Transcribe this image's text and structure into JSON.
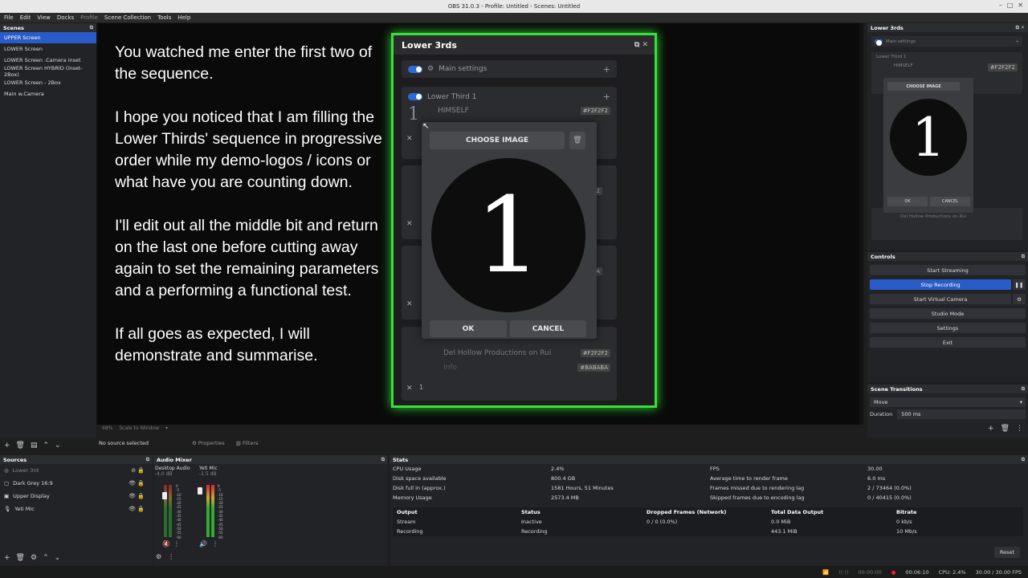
{
  "window": {
    "title": "OBS 31.0.3 - Profile: Untitled - Scenes: Untitled"
  },
  "menu": [
    "File",
    "Edit",
    "View",
    "Docks",
    "Profile",
    "Scene Collection",
    "Tools",
    "Help"
  ],
  "scenes": {
    "header": "Scenes",
    "items": [
      "UPPER Screen",
      "LOWER Screen",
      "LOWER Screen .Camera inset",
      "LOWER Screen  HYBRID (inset-2Box)",
      "LOWER Screen - 2Box",
      "Main  w.Camera"
    ]
  },
  "preview": {
    "overlay_paragraphs": [
      "You watched me enter the first two of the sequence.",
      "I hope you noticed that I am filling the Lower Thirds' sequence in progressive order while my demo-logos / icons or what have you are counting down.",
      "I'll edit out all the middle bit and return on the last one before cutting away again to set the remaining parameters and a performing a functional test.",
      "If all goes as expected, I will demonstrate and summarise."
    ],
    "zoom": "68%",
    "scale_mode": "Scale to Window"
  },
  "lower3rds": {
    "title": "Lower 3rds",
    "main_settings": "Main settings",
    "lt1_name": "Lower Third 1",
    "lt1_text": "HIMSELF",
    "lt1_color": "#F2F2F2",
    "card_colors": [
      "#F2F2F2",
      "#BABABA"
    ],
    "lt4_text": "Del Hollow Productions on Rui",
    "lt4_info": "Info",
    "lt4_color": "#F2F2F2",
    "lt4_color2": "#BABABA",
    "num_badge": "1"
  },
  "modal": {
    "choose_label": "CHOOSE IMAGE",
    "image_numeral": "1",
    "ok_label": "OK",
    "cancel_label": "CANCEL"
  },
  "lt_dock": {
    "header": "Lower 3rds",
    "main_settings": "Main settings",
    "lt1_name": "Lower Third 1",
    "lt1_text": "HIMSELF",
    "lt1_color": "#F2F2F2",
    "lt4_text": "Del Hollow Productions on Rui",
    "choose_label": "CHOOSE IMAGE",
    "numeral": "1",
    "ok_label": "OK",
    "cancel_label": "CANCEL"
  },
  "controls": {
    "header": "Controls",
    "buttons": [
      "Start Streaming",
      "Stop Recording",
      "Start Virtual Camera",
      "Studio Mode",
      "Settings",
      "Exit"
    ]
  },
  "transitions": {
    "header": "Scene Transitions",
    "type": "Move",
    "duration_label": "Duration",
    "duration_value": "500 ms"
  },
  "toolbar": {
    "no_source": "No source selected",
    "properties": "Properties",
    "filters": "Filters"
  },
  "sources": {
    "header": "Sources",
    "items": [
      "Lower 3rd",
      "Dark Grey 16:9",
      "Upper Display",
      "Yeti Mic"
    ]
  },
  "mixer": {
    "header": "Audio Mixer",
    "channels": [
      {
        "name": "Desktop Audio",
        "db": "-4.0 dB"
      },
      {
        "name": "Yeti Mic",
        "db": "-1.5 dB"
      }
    ],
    "scale": [
      "0",
      "-5",
      "-10",
      "-15",
      "-20",
      "-25",
      "-30",
      "-35",
      "-40",
      "-45",
      "-50",
      "-55",
      "-60"
    ]
  },
  "stats": {
    "header": "Stats",
    "left": [
      {
        "label": "CPU Usage",
        "value": "2.4%"
      },
      {
        "label": "Disk space available",
        "value": "800.4 GB"
      },
      {
        "label": "Disk full in (approx.)",
        "value": "1581 Hours, 51 Minutes"
      },
      {
        "label": "Memory Usage",
        "value": "2573.4 MB"
      }
    ],
    "right": [
      {
        "label": "FPS",
        "value": "30.00"
      },
      {
        "label": "Average time to render frame",
        "value": "6.0 ms"
      },
      {
        "label": "Frames missed due to rendering lag",
        "value": "2 / 73464 (0.0%)"
      },
      {
        "label": "Skipped frames due to encoding lag",
        "value": "0 / 40415 (0.0%)"
      }
    ],
    "table_head": [
      "Output",
      "Status",
      "Dropped Frames (Network)",
      "Total Data Output",
      "Bitrate"
    ],
    "rows": [
      [
        "Stream",
        "Inactive",
        "0 / 0 (0.0%)",
        "0.0 MiB",
        "0 kb/s"
      ],
      [
        "Recording",
        "Recording",
        "",
        "443.1 MiB",
        "10 Mb/s"
      ]
    ],
    "reset_label": "Reset"
  },
  "statusbar": {
    "stream_time": "00:00:00",
    "rec_time": "00:06:10",
    "cpu": "CPU: 2.4%",
    "fps": "30.00 / 30.00 FPS"
  },
  "colors": {
    "accent": "#2a5cc9",
    "green_border": "#35e13a"
  }
}
